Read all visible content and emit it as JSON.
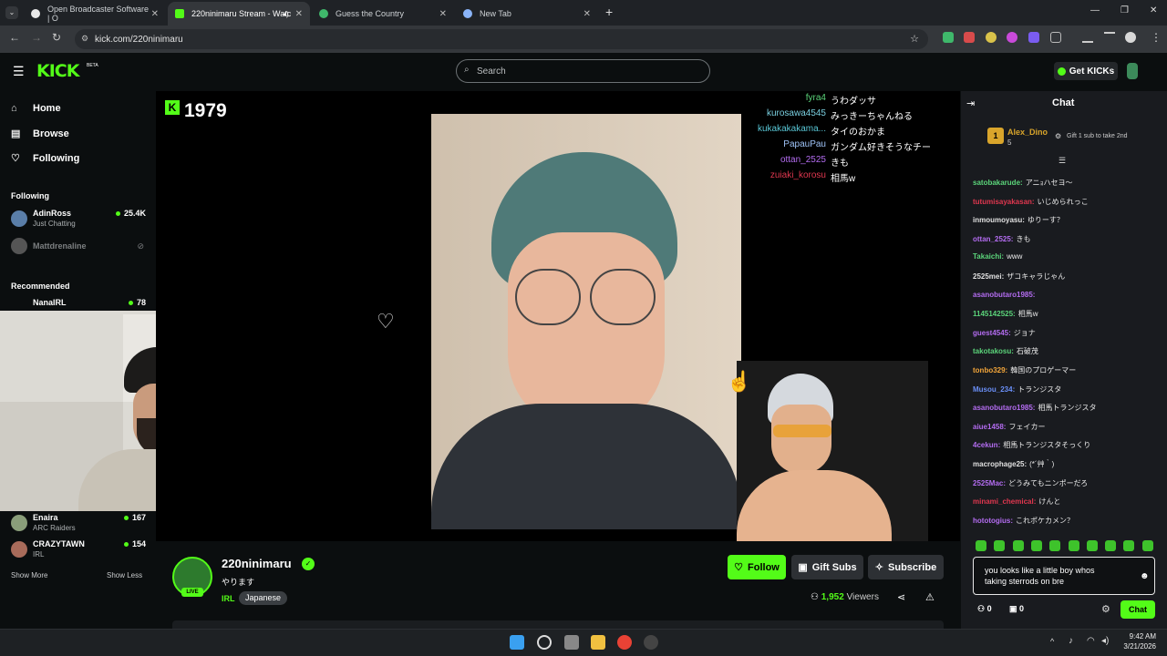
{
  "browser": {
    "tabs": [
      {
        "label": "Open Broadcaster Software | O"
      },
      {
        "label": "220ninimaru Stream - Watc"
      },
      {
        "label": "Guess the Country"
      },
      {
        "label": "New Tab"
      }
    ],
    "url": "kick.com/220ninimaru",
    "new_tab": "+"
  },
  "kick": {
    "logo": "KICK",
    "beta": "BETA",
    "search_placeholder": "Search",
    "get_kicks": "Get KICKs"
  },
  "sidebar": {
    "nav": [
      {
        "label": "Home",
        "icon": "⌂"
      },
      {
        "label": "Browse",
        "icon": "▤"
      },
      {
        "label": "Following",
        "icon": "♡"
      }
    ],
    "following_header": "Following",
    "following": [
      {
        "name": "AdinRoss",
        "category": "Just Chatting",
        "viewers": "25.4K"
      },
      {
        "name": "Mattdrenaline",
        "category": "",
        "viewers": ""
      }
    ],
    "recommended_header": "Recommended",
    "recommended": [
      {
        "name": "NanaIRL",
        "category": "",
        "viewers": "78"
      },
      {
        "name": "Enaira",
        "category": "ARC Raiders",
        "viewers": "167"
      },
      {
        "name": "CRAZYTAWN",
        "category": "IRL",
        "viewers": "154"
      }
    ],
    "show_more": "Show More",
    "show_less": "Show Less"
  },
  "player": {
    "kick_count": "1979",
    "overlay_chat": [
      {
        "user": "fyra4",
        "msg": "うわダッサ",
        "color": "#5bd47a"
      },
      {
        "user": "kurosawa4545",
        "msg": "みっきーちゃんねる",
        "color": "#7ad0e0"
      },
      {
        "user": "kukakakakama...",
        "msg": "タイのおかま",
        "color": "#59c7d6"
      },
      {
        "user": "PapauPau",
        "msg": "ガンダム好きそうなチー",
        "color": "#9fc3f7"
      },
      {
        "user": "ottan_2525",
        "msg": "きも",
        "color": "#b36cf0"
      },
      {
        "user": "zuiaki_korosu",
        "msg": "相馬w",
        "color": "#e0374f"
      }
    ]
  },
  "channel": {
    "name": "220ninimaru",
    "title": "やります",
    "category": "IRL",
    "tag": "Japanese",
    "live": "LIVE",
    "follow": "Follow",
    "gift_subs": "Gift Subs",
    "subscribe": "Subscribe",
    "viewers": "1,952",
    "viewers_label": "Viewers"
  },
  "chat": {
    "title": "Chat",
    "top_gifter": {
      "rank": "1",
      "name": "Alex_Dino",
      "count": "5"
    },
    "gift_prompt": "Gift 1 sub to take 2nd",
    "messages": [
      {
        "user": "satobakarude:",
        "msg": "アニｮハセヨ〜",
        "color": "#5bd47a"
      },
      {
        "user": "tutumisayakasan:",
        "msg": "いじめられっこ",
        "color": "#e0374f"
      },
      {
        "user": "inmoumoyasu:",
        "msg": "ゆりーす？",
        "color": "#e0e0e0"
      },
      {
        "user": "ottan_2525:",
        "msg": "きも",
        "color": "#b36cf0"
      },
      {
        "user": "Takaichi:",
        "msg": "www",
        "color": "#5bd47a"
      },
      {
        "user": "2525mei:",
        "msg": "ザコキャラじゃん",
        "color": "#e0e0e0"
      },
      {
        "user": "asanobutaro1985:",
        "msg": "",
        "color": "#b36cf0"
      },
      {
        "user": "1145142525:",
        "msg": "相馬w",
        "color": "#5bd47a"
      },
      {
        "user": "guest4545:",
        "msg": "ジョナ",
        "color": "#b36cf0"
      },
      {
        "user": "takotakosu:",
        "msg": "石破茂",
        "color": "#5bd47a"
      },
      {
        "user": "tonbo329:",
        "msg": "韓国のプロゲーマー",
        "color": "#f2a53a"
      },
      {
        "user": "Musou_234:",
        "msg": "トランジスタ",
        "color": "#6a8ff7"
      },
      {
        "user": "asanobutaro1985:",
        "msg": "相馬トランジスタ",
        "color": "#b36cf0"
      },
      {
        "user": "aiue1458:",
        "msg": "フェイカー",
        "color": "#b36cf0"
      },
      {
        "user": "4cekun:",
        "msg": "相馬トランジスタそっくり",
        "color": "#b36cf0"
      },
      {
        "user": "macrophage25:",
        "msg": "(*´艸｀)",
        "color": "#e0e0e0"
      },
      {
        "user": "2525Mac:",
        "msg": "どうみてもニンポーだろ",
        "color": "#b36cf0"
      },
      {
        "user": "minami_chemical:",
        "msg": "けんと",
        "color": "#e0374f"
      },
      {
        "user": "hototogius:",
        "msg": "これポケカメン？",
        "color": "#b36cf0"
      }
    ],
    "input_line1": "you looks like a little boy whos",
    "input_line2": "taking sterrods on bre",
    "kicks": "0",
    "subs": "0",
    "send": "Chat"
  },
  "taskbar": {
    "time": "9:42 AM",
    "date": "3/21/2026"
  }
}
